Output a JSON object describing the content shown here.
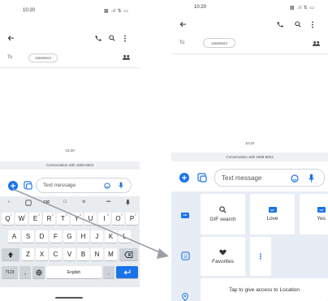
{
  "left": {
    "status": {
      "time": "10:20",
      "icons": "▩ .ıl ⇅ ▭"
    },
    "to_label": "To",
    "recipient": "18668923",
    "message_time": "10:20",
    "conversation_info": "Conversation with 1868 8923",
    "text_placeholder": "Text message",
    "keyboard": {
      "toolbar": [
        "‹",
        "GIF",
        "☐",
        "⚙",
        "•••"
      ],
      "row1": [
        "Q",
        "W",
        "E",
        "R",
        "T",
        "Y",
        "U",
        "I",
        "O",
        "P"
      ],
      "row1_hints": [
        "1",
        "2",
        "3",
        "4",
        "5",
        "6",
        "7",
        "8",
        "9",
        "0"
      ],
      "row2": [
        "A",
        "S",
        "D",
        "F",
        "G",
        "H",
        "J",
        "K",
        "L"
      ],
      "row3": [
        "Z",
        "X",
        "C",
        "V",
        "B",
        "N",
        "M"
      ],
      "symbols_key": "?123",
      "comma_key": ",",
      "space_key": "English",
      "period_key": "."
    }
  },
  "right": {
    "status": {
      "time": "10:20",
      "icons": "▩ .ıl ⇅ ▭"
    },
    "to_label": "To",
    "recipient": "18668923",
    "message_time": "10:20",
    "conversation_info": "Conversation with 1868 8923",
    "text_placeholder": "Text message",
    "media": {
      "gif_search": "GIF search",
      "love": "Love",
      "yes": "Yes",
      "favorites": "Favorites",
      "more": "⋮",
      "gif_badge": "GIF",
      "location": "Tap to give access to Location"
    }
  },
  "colors": {
    "accent": "#1a73e8",
    "panel": "#e8edf5",
    "keyboard": "#e9ecef"
  }
}
